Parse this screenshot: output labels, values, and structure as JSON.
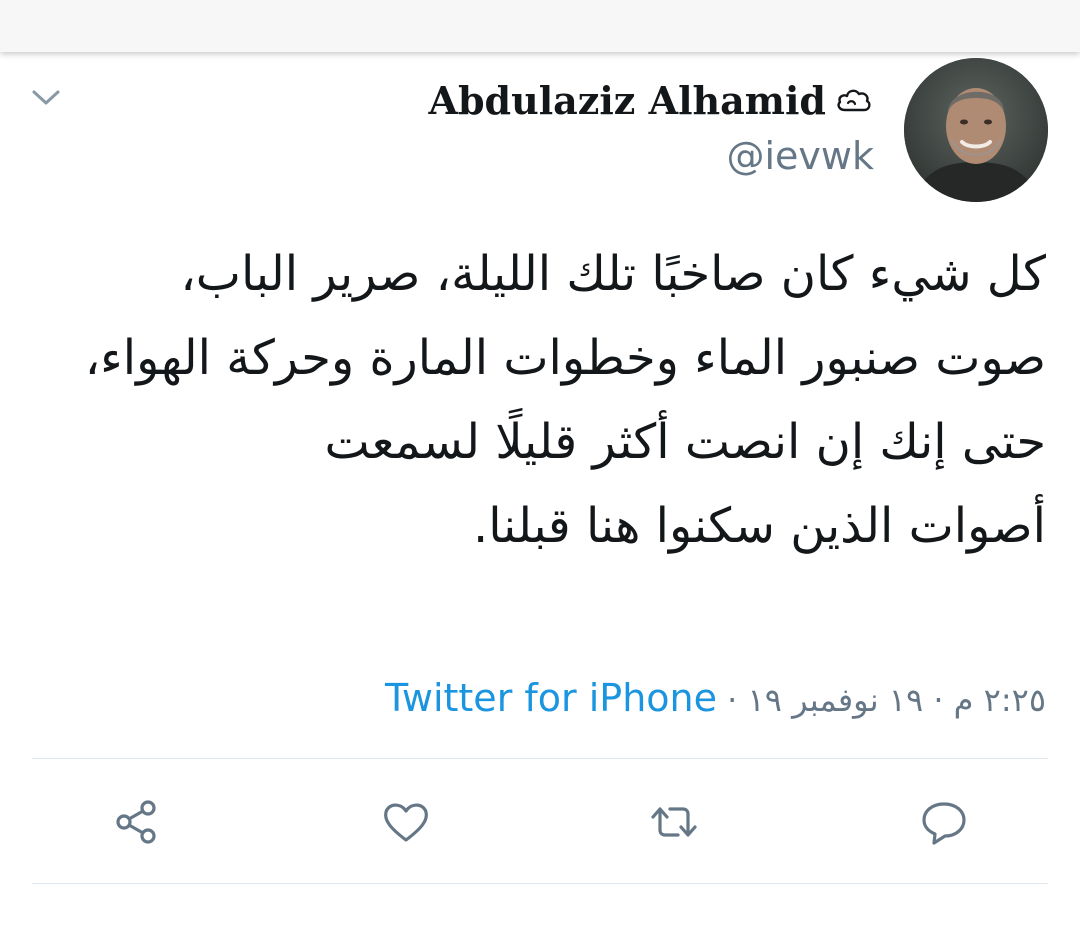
{
  "user": {
    "name": "Abdulaziz Alhamid",
    "handle": "@ievwk",
    "name_badge_icon": "cloud-icon"
  },
  "tweet": {
    "text": "كل شيء كان صاخبًا تلك الليلة، صرير الباب،\nصوت صنبور الماء وخطوات المارة وحركة الهواء،\nحتى إنك إن انصت أكثر قليلًا لسمعت\nأصوات الذين سكنوا هنا قبلنا.",
    "time": "٢:٢٥ م",
    "date": "١٩ نوفمبر ١٩",
    "separator": "·",
    "source": "Twitter for iPhone"
  },
  "actions": {
    "reply_icon": "reply-icon",
    "retweet_icon": "retweet-icon",
    "like_icon": "heart-icon",
    "share_icon": "share-icon"
  },
  "colors": {
    "text": "#14171a",
    "secondary": "#657786",
    "link": "#1b95e0",
    "icon": "#657786",
    "divider": "#e1e8ed"
  }
}
